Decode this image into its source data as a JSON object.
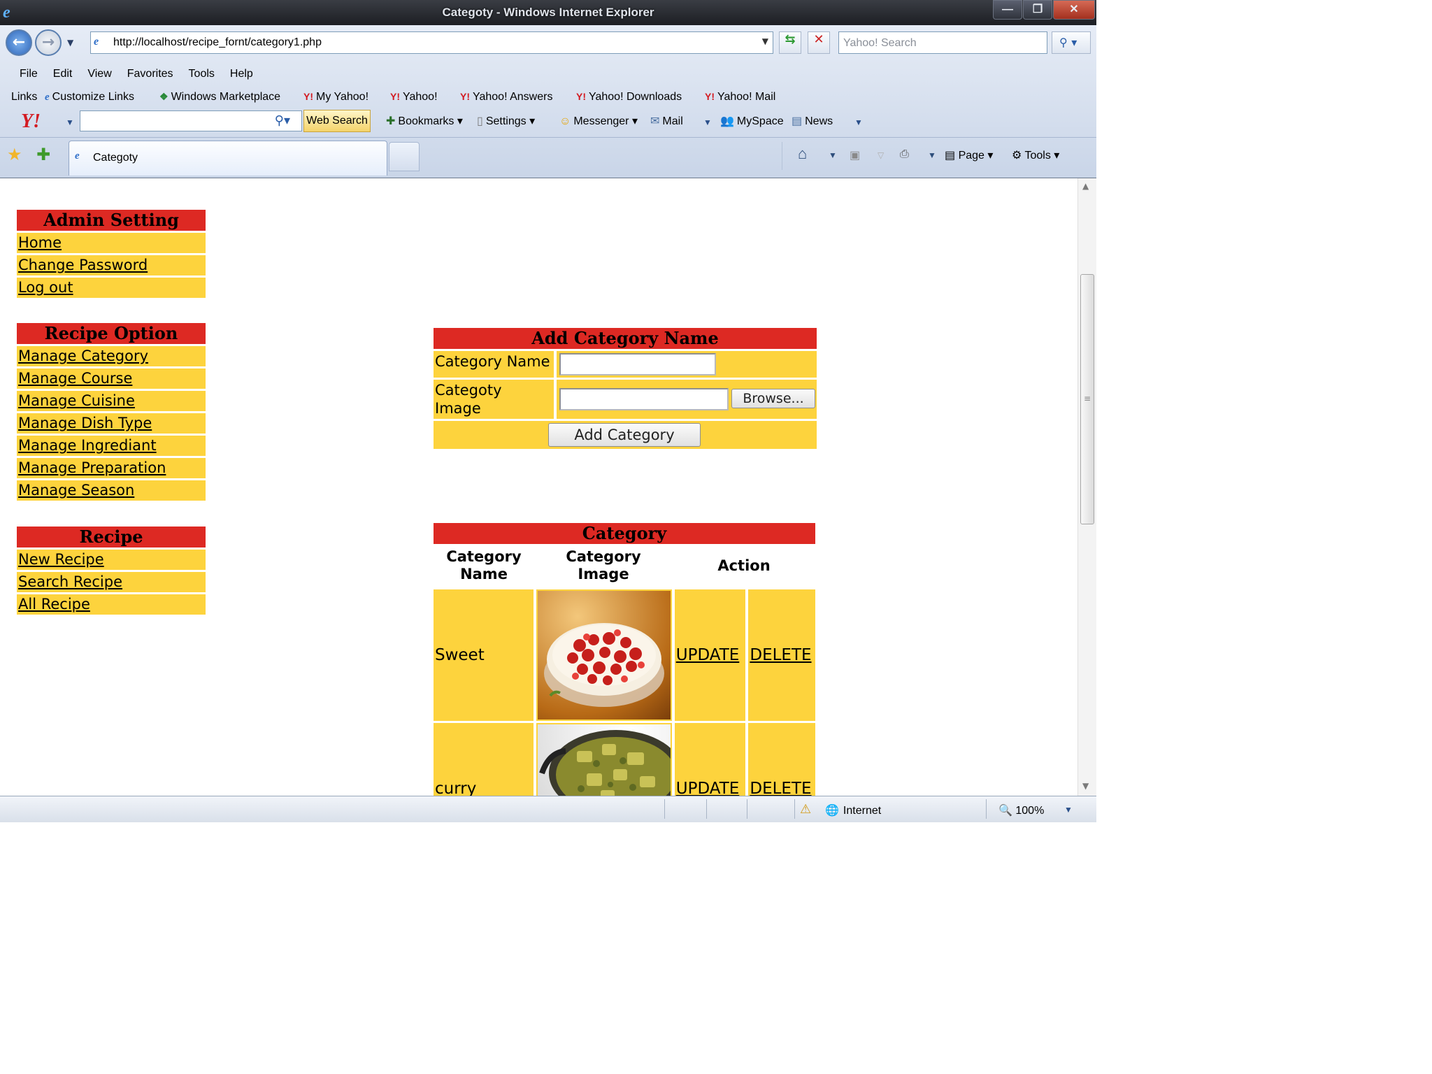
{
  "window": {
    "title": "Categoty - Windows Internet Explorer",
    "buttons": {
      "minimize": "—",
      "restore": "❐",
      "close": "✕"
    }
  },
  "address_bar": {
    "url": "http://localhost/recipe_fornt/category1.php",
    "search_placeholder": "Yahoo! Search"
  },
  "menu": [
    "File",
    "Edit",
    "View",
    "Favorites",
    "Tools",
    "Help"
  ],
  "links_bar": {
    "label": "Links",
    "items": [
      "Customize Links",
      "Windows Marketplace",
      "My Yahoo!",
      "Yahoo!",
      "Yahoo! Answers",
      "Yahoo! Downloads",
      "Yahoo! Mail"
    ]
  },
  "yahoo_toolbar": {
    "logo": "Y!",
    "web_search": "Web Search",
    "items": [
      "Bookmarks",
      "Settings",
      "Messenger",
      "Mail",
      "MySpace",
      "News"
    ]
  },
  "tabs": {
    "active": "Categoty"
  },
  "command_bar": {
    "page": "Page",
    "tools": "Tools"
  },
  "sidebar": {
    "admin": {
      "title": "Admin Setting",
      "items": [
        "Home",
        "Change Password",
        "Log out"
      ]
    },
    "recipe_option": {
      "title": "Recipe Option",
      "items": [
        "Manage Category",
        "Manage Course",
        "Manage Cuisine",
        "Manage Dish Type",
        "Manage Ingrediant",
        "Manage Preparation",
        "Manage Season"
      ]
    },
    "recipe": {
      "title": "Recipe",
      "items": [
        "New Recipe",
        "Search Recipe",
        "All Recipe"
      ]
    }
  },
  "add_form": {
    "title": "Add Category Name",
    "name_label": "Category Name",
    "image_label_line1": "Categoty",
    "image_label_line2": "Image",
    "browse": "Browse...",
    "submit": "Add Category"
  },
  "category_table": {
    "title": "Category",
    "headers": {
      "name_line1": "Category",
      "name_line2": "Name",
      "image_line1": "Category",
      "image_line2": "Image",
      "action": "Action"
    },
    "rows": [
      {
        "name": "Sweet",
        "update": "UPDATE",
        "delete": "DELETE"
      },
      {
        "name": "curry",
        "update": "UPDATE",
        "delete": "DELETE"
      }
    ]
  },
  "status_bar": {
    "zone": "Internet",
    "zoom": "100%"
  },
  "colors": {
    "header_red": "#dd2923",
    "cell_yellow": "#fdd33d"
  }
}
